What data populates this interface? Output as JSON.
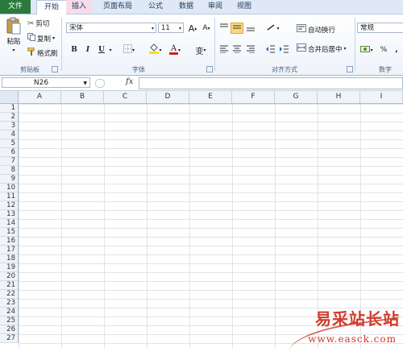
{
  "tabs": {
    "file": "文件",
    "home": "开始",
    "insert": "插入",
    "page_layout": "页面布局",
    "formulas": "公式",
    "data": "数据",
    "review": "审阅",
    "view": "视图"
  },
  "clipboard": {
    "paste": "粘贴",
    "cut": "剪切",
    "copy": "复制",
    "format_painter": "格式刷",
    "group_label": "剪贴板"
  },
  "font": {
    "name": "宋体",
    "size": "11",
    "bold": "B",
    "italic": "I",
    "underline": "U",
    "font_color_glyph": "A",
    "phonetic_glyph": "变",
    "grow_glyph": "A",
    "shrink_glyph": "A",
    "group_label": "字体"
  },
  "alignment": {
    "wrap_text": "自动换行",
    "merge_center": "合并后居中",
    "group_label": "对齐方式"
  },
  "number": {
    "format": "常规",
    "percent": "%",
    "comma": ",",
    "group_label": "数字"
  },
  "formula_bar": {
    "name_box": "N26",
    "fx": "fx",
    "formula": ""
  },
  "grid": {
    "columns": [
      "A",
      "B",
      "C",
      "D",
      "E",
      "F",
      "G",
      "H",
      "I"
    ],
    "rows": [
      "1",
      "2",
      "3",
      "4",
      "5",
      "6",
      "7",
      "8",
      "9",
      "10",
      "11",
      "12",
      "13",
      "14",
      "15",
      "16",
      "17",
      "18",
      "19",
      "20",
      "21",
      "22",
      "23",
      "24",
      "25",
      "26",
      "27"
    ]
  },
  "watermark": {
    "title": "易采站长站",
    "url": "www.easck.com"
  },
  "colors": {
    "file_tab": "#2a7a3b",
    "insert_tab": "#f6dcea",
    "ribbon_bg": "#eef3fa",
    "watermark": "#d23b2c",
    "font_color_bar": "#d02020",
    "fill_color_bar": "#ffe200"
  }
}
